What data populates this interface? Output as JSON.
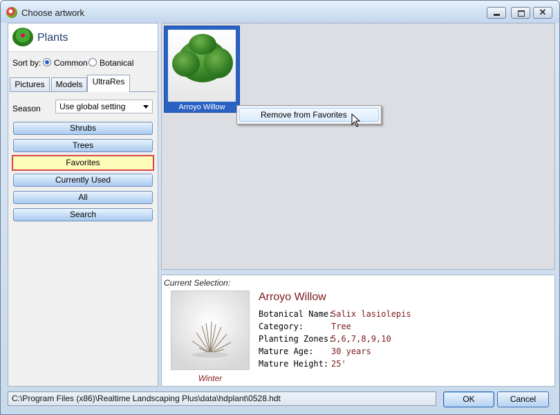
{
  "window": {
    "title": "Choose artwork",
    "buttons": {
      "minimize": "minimize-icon",
      "maximize": "maximize-icon",
      "close": "✕"
    }
  },
  "left": {
    "header": "Plants",
    "sort": {
      "label": "Sort by:",
      "options": [
        "Common",
        "Botanical"
      ],
      "selected": "Common"
    },
    "tabs": [
      "Pictures",
      "Models",
      "UltraRes"
    ],
    "active_tab": "UltraRes",
    "season": {
      "label": "Season",
      "value": "Use global setting"
    },
    "categories": [
      "Shrubs",
      "Trees",
      "Favorites",
      "Currently Used",
      "All",
      "Search"
    ],
    "selected_category": "Favorites"
  },
  "gallery": {
    "items": [
      {
        "label": "Arroyo Willow"
      }
    ],
    "context_menu": {
      "item": "Remove from Favorites"
    }
  },
  "detail": {
    "heading": "Current Selection:",
    "name": "Arroyo Willow",
    "image_caption": "Winter",
    "fields": [
      {
        "label": "Botanical Name:",
        "value": "Salix lasiolepis"
      },
      {
        "label": "Category:",
        "value": "Tree"
      },
      {
        "label": "Planting Zones:",
        "value": "5,6,7,8,9,10"
      },
      {
        "label": "Mature Age:",
        "value": "30 years"
      },
      {
        "label": "Mature Height:",
        "value": "25'"
      }
    ]
  },
  "status": {
    "path": "C:\\Program Files (x86)\\Realtime Landscaping Plus\\data\\hdplant\\0528.hdt"
  },
  "buttons": {
    "ok": "OK",
    "cancel": "Cancel"
  },
  "colors": {
    "accent": "#2a62c4",
    "value_text": "#7a1a1a",
    "favorite_bg": "#fdfcb8",
    "favorite_border": "#d9474a"
  }
}
